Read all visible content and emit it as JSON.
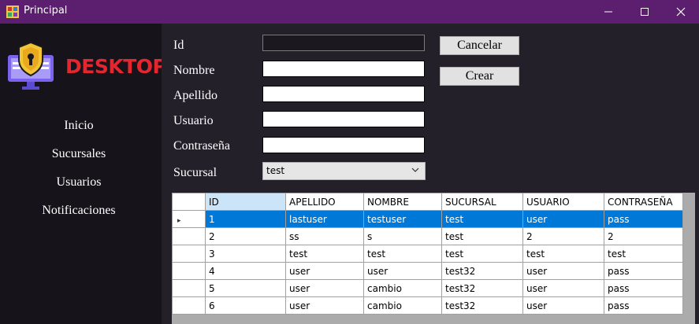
{
  "window": {
    "title": "Principal",
    "controls": {
      "minimize_glyph": "—",
      "maximize_glyph": "☐",
      "close_glyph": "✕"
    }
  },
  "sidebar": {
    "brand": "DESKTOP",
    "logo_icon": "monitor-shield-lock-icon",
    "items": [
      {
        "label": "Inicio"
      },
      {
        "label": "Sucursales"
      },
      {
        "label": "Usuarios"
      },
      {
        "label": "Notificaciones"
      }
    ]
  },
  "form": {
    "id_label": "Id",
    "nombre_label": "Nombre",
    "apellido_label": "Apellido",
    "usuario_label": "Usuario",
    "contrasena_label": "Contraseña",
    "sucursal_label": "Sucursal",
    "id_value": "",
    "nombre_value": "",
    "apellido_value": "",
    "usuario_value": "",
    "contrasena_value": "",
    "sucursal_value": "test",
    "cancel_label": "Cancelar",
    "create_label": "Crear"
  },
  "grid": {
    "columns": [
      "ID",
      "APELLIDO",
      "NOMBRE",
      "SUCURSAL",
      "USUARIO",
      "CONTRASEÑA"
    ],
    "selected_row": 0,
    "row_indicator": "▸",
    "rows": [
      [
        "1",
        "lastuser",
        "testuser",
        "test",
        "user",
        "pass"
      ],
      [
        "2",
        "ss",
        "s",
        "test",
        "2",
        "2"
      ],
      [
        "3",
        "test",
        "test",
        "test",
        "test",
        "test"
      ],
      [
        "4",
        "user",
        "user",
        "test32",
        "user",
        "pass"
      ],
      [
        "5",
        "user",
        "cambio",
        "test32",
        "user",
        "pass"
      ],
      [
        "6",
        "user",
        "cambio",
        "test32",
        "user",
        "pass"
      ]
    ]
  },
  "colors": {
    "titlebar": "#5c1e6e",
    "sidebar": "#16131a",
    "main": "#24202a",
    "brand": "#e5262e",
    "selection": "#0078d7",
    "header_selected": "#cce4f7"
  }
}
